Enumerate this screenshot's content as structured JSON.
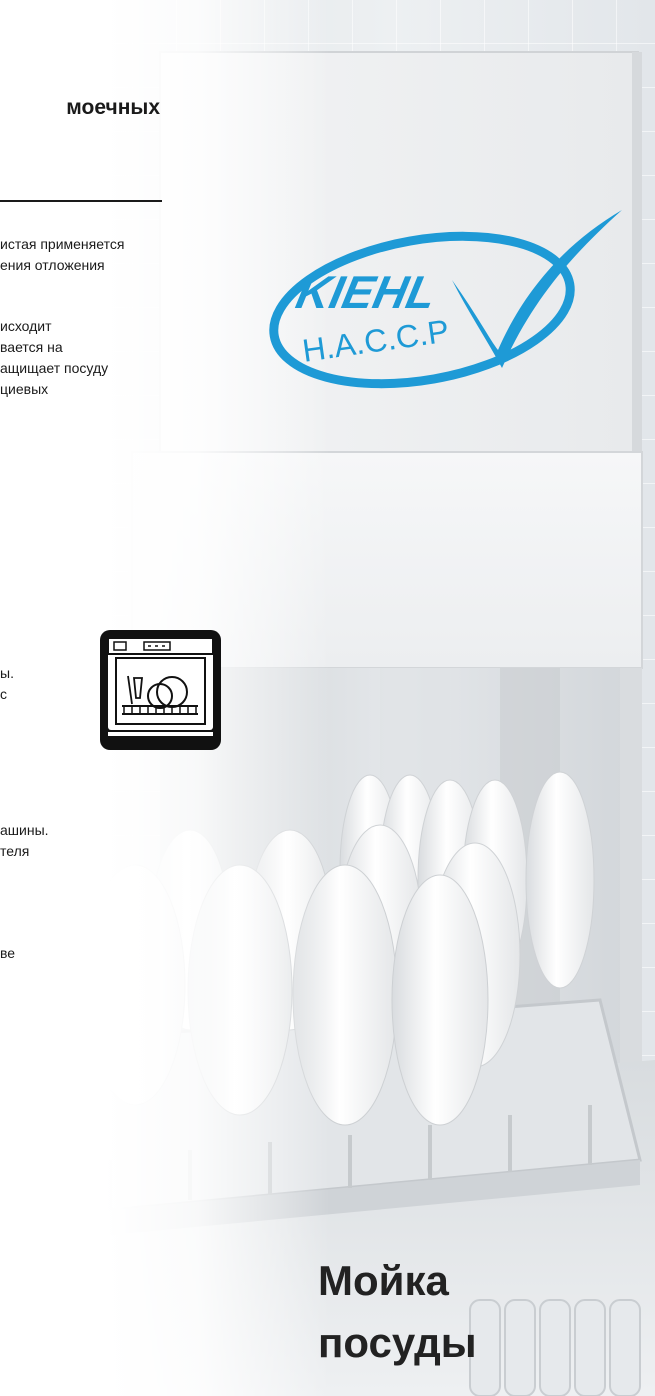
{
  "header": {
    "heading": "моечных"
  },
  "paragraphs": {
    "p1": [
      "истая применяется",
      "ения отложения"
    ],
    "p2": [
      "исходит",
      "вается на",
      "ащищает посуду",
      "циевых"
    ],
    "p3": [
      "ы.",
      "с"
    ],
    "p4": [
      "ашины.",
      "теля"
    ],
    "p5": [
      "ве"
    ]
  },
  "logo": {
    "brand": "KIEHL",
    "subtitle": "H.A.C.C.P",
    "color": "#1e9ad6"
  },
  "title": {
    "line1": "Мойка",
    "line2": "посуды"
  },
  "icons": {
    "dishwasher": "dishwasher-icon"
  }
}
